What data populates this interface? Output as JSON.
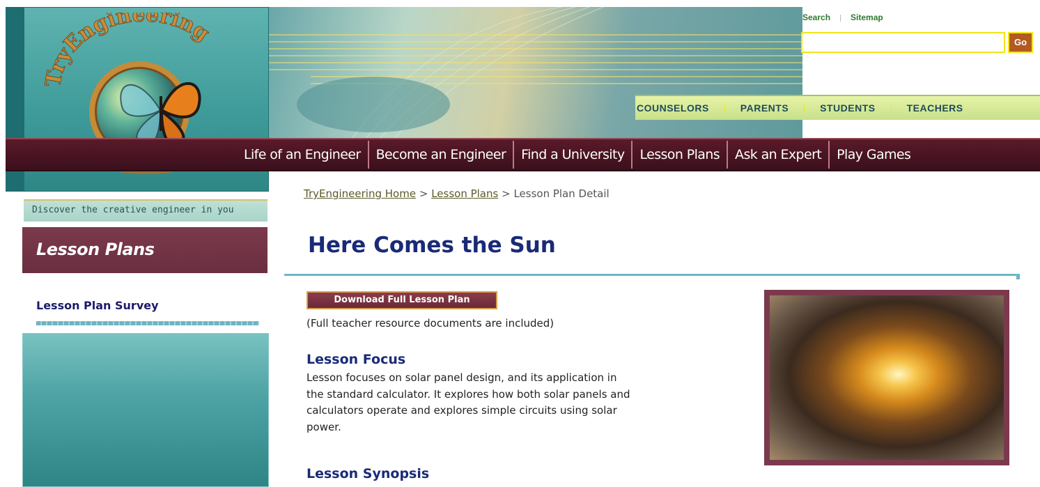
{
  "header": {
    "util_links": [
      "Search",
      "Sitemap"
    ],
    "search_placeholder": "",
    "go_label": "Go",
    "audience": [
      "COUNSELORS",
      "PARENTS",
      "STUDENTS",
      "TEACHERS"
    ],
    "nav": [
      "Life of an Engineer",
      "Become an Engineer",
      "Find a University",
      "Lesson Plans",
      "Ask an Expert",
      "Play Games"
    ],
    "tagline": "Discover the creative engineer in you",
    "logo_text": "TryEngineering"
  },
  "sidebar": {
    "section_title": "Lesson Plans",
    "survey_link": "Lesson Plan Survey"
  },
  "breadcrumb": {
    "home": "TryEngineering Home",
    "sep1": " > ",
    "plans": "Lesson Plans",
    "sep2": " > ",
    "current": "Lesson Plan Detail"
  },
  "main": {
    "title": "Here Comes the Sun",
    "download_label": "Download Full Lesson Plan",
    "resource_note": "(Full teacher resource documents are included)",
    "focus_heading": "Lesson Focus",
    "focus_text": "Lesson focuses on solar panel design, and its application in the standard calculator. It explores how both solar panels and calculators operate and explores simple circuits using solar power.",
    "synopsis_heading": "Lesson Synopsis"
  },
  "colors": {
    "nav_bg": "#4a1422",
    "title_blue": "#1a2a78",
    "accent_teal": "#4ea3a5",
    "section_maroon": "#7b3a4c",
    "search_border": "#f2e516"
  }
}
